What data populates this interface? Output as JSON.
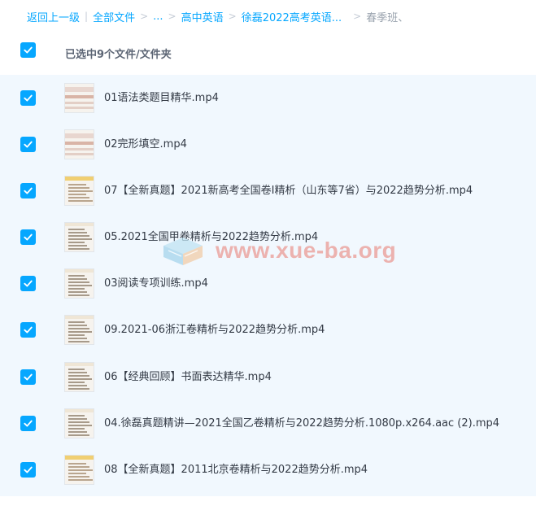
{
  "breadcrumb": {
    "back": "返回上一级",
    "all_files": "全部文件",
    "ellipsis": "...",
    "folder1": "高中英语",
    "folder2": "徐磊2022高考英语...",
    "current": "春季班、"
  },
  "header": {
    "selected_text": "已选中9个文件/文件夹"
  },
  "files": [
    {
      "name": "01语法类题目精华.mp4",
      "thumb": "thumb-red"
    },
    {
      "name": "02完形填空.mp4",
      "thumb": "thumb-red"
    },
    {
      "name": "07【全新真题】2021新高考全国卷I精析（山东等7省）与2022趋势分析.mp4",
      "thumb": "thumb-yellow"
    },
    {
      "name": "05.2021全国甲卷精析与2022趋势分析.mp4",
      "thumb": "thumb-doc"
    },
    {
      "name": "03阅读专项训练.mp4",
      "thumb": "thumb-doc"
    },
    {
      "name": "09.2021-06浙江卷精析与2022趋势分析.mp4",
      "thumb": "thumb-doc"
    },
    {
      "name": "06【经典回顾】书面表达精华.mp4",
      "thumb": "thumb-doc"
    },
    {
      "name": "04.徐磊真题精讲—2021全国乙卷精析与2022趋势分析.1080p.x264.aac (2).mp4",
      "thumb": "thumb-doc"
    },
    {
      "name": "08【全新真题】2011北京卷精析与2022趋势分析.mp4",
      "thumb": "thumb-yellow"
    }
  ],
  "watermark": {
    "text": "www.xue-ba.org"
  },
  "colors": {
    "accent": "#06a7ff",
    "list_bg": "#f1f8fe"
  }
}
